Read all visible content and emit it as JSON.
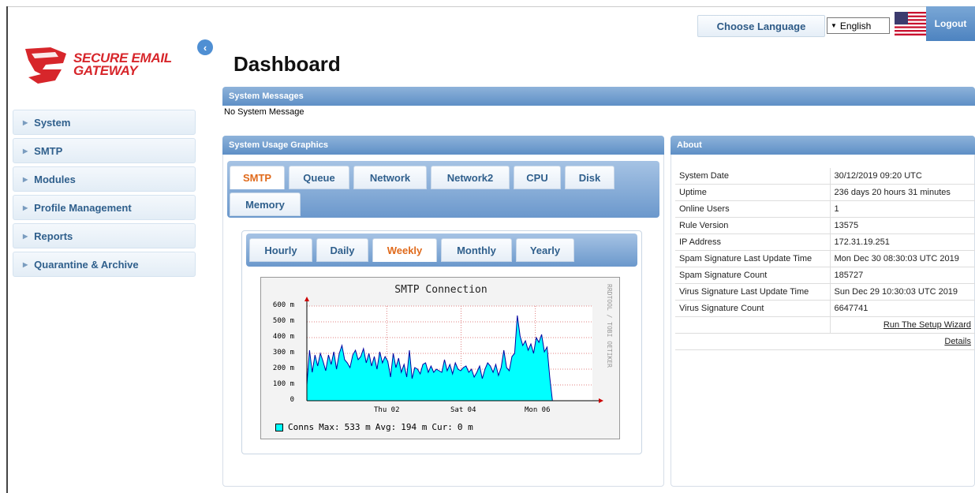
{
  "topbar": {
    "choose_language": "Choose Language",
    "language_value": "English",
    "logout": "Logout"
  },
  "logo": {
    "line1": "SECURE EMAIL",
    "line2": "GATEWAY"
  },
  "page_title": "Dashboard",
  "sidebar": {
    "items": [
      {
        "label": "System"
      },
      {
        "label": "SMTP"
      },
      {
        "label": "Modules"
      },
      {
        "label": "Profile Management"
      },
      {
        "label": "Reports"
      },
      {
        "label": "Quarantine & Archive"
      }
    ]
  },
  "system_messages": {
    "title": "System Messages",
    "text": "No System Message"
  },
  "usage": {
    "title": "System Usage Graphics",
    "tabs": [
      "SMTP",
      "Queue",
      "Network",
      "Network2",
      "CPU",
      "Disk",
      "Memory"
    ],
    "active_tab": "SMTP",
    "subtabs": [
      "Hourly",
      "Daily",
      "Weekly",
      "Monthly",
      "Yearly"
    ],
    "active_subtab": "Weekly"
  },
  "chart_data": {
    "type": "area",
    "title": "SMTP Connection",
    "side_label": "RRDTOOL / TOBI OETIKER",
    "y_ticks": [
      "600 m",
      "500 m",
      "400 m",
      "300 m",
      "200 m",
      "100 m",
      "0"
    ],
    "x_ticks": [
      "Thu 02",
      "Sat 04",
      "Mon 06"
    ],
    "ylim": [
      0,
      600
    ],
    "grid": true,
    "series": [
      {
        "name": "Conns",
        "color": "#00ffff",
        "values": [
          100,
          320,
          180,
          290,
          220,
          300,
          250,
          190,
          290,
          230,
          310,
          200,
          300,
          350,
          260,
          240,
          210,
          290,
          320,
          260,
          280,
          330,
          240,
          300,
          220,
          280,
          200,
          310,
          240,
          280,
          250,
          150,
          300,
          210,
          270,
          180,
          230,
          150,
          320,
          140,
          210,
          200,
          170,
          230,
          240,
          180,
          220,
          180,
          200,
          190,
          180,
          260,
          190,
          230,
          170,
          240,
          200,
          190,
          210,
          220,
          180,
          200,
          150,
          180,
          220,
          140,
          200,
          240,
          220,
          180,
          230,
          160,
          210,
          320,
          210,
          190,
          280,
          300,
          540,
          410,
          350,
          380,
          320,
          360,
          300,
          400,
          370,
          420,
          310,
          340,
          150,
          0
        ]
      }
    ],
    "legend": {
      "label": "Conns",
      "max_label": "Max:",
      "max_value": "533 m",
      "avg_label": "Avg:",
      "avg_value": "194 m",
      "cur_label": "Cur:",
      "cur_value": "0 m"
    }
  },
  "about": {
    "title": "About",
    "rows": [
      {
        "key": "System Date",
        "value": "30/12/2019 09:20 UTC"
      },
      {
        "key": "Uptime",
        "value": "236 days 20 hours 31 minutes"
      },
      {
        "key": "Online Users",
        "value": "1"
      },
      {
        "key": "Rule Version",
        "value": "13575"
      },
      {
        "key": "IP Address",
        "value": "172.31.19.251"
      },
      {
        "key": "Spam Signature Last Update Time",
        "value": "Mon Dec 30 08:30:03 UTC 2019"
      },
      {
        "key": "Spam Signature Count",
        "value": "185727"
      },
      {
        "key": "Virus Signature Last Update Time",
        "value": "Sun Dec 29 10:30:03 UTC 2019"
      },
      {
        "key": "Virus Signature Count",
        "value": "6647741"
      }
    ],
    "setup_wizard": "Run The Setup Wizard",
    "details": "Details"
  },
  "colors": {
    "brand_red": "#d7262b",
    "header_blue": "#5e8fc6",
    "active_tab_orange": "#e06a1b"
  }
}
